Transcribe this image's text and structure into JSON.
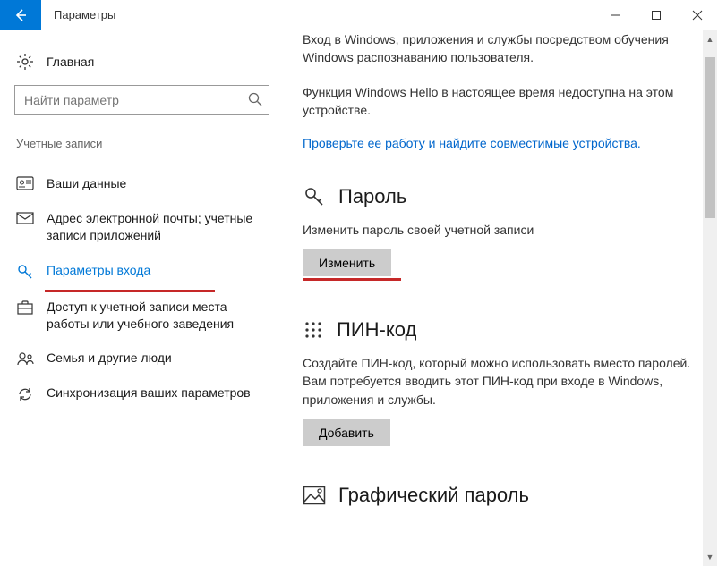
{
  "titlebar": {
    "title": "Параметры"
  },
  "sidebar": {
    "home_label": "Главная",
    "search_placeholder": "Найти параметр",
    "category_label": "Учетные записи",
    "items": [
      {
        "label": "Ваши данные"
      },
      {
        "label": "Адрес электронной почты; учетные записи приложений"
      },
      {
        "label": "Параметры входа"
      },
      {
        "label": "Доступ к учетной записи места работы или учебного заведения"
      },
      {
        "label": "Семья и другие люди"
      },
      {
        "label": "Синхронизация ваших параметров"
      }
    ]
  },
  "main": {
    "hello_text1": "Вход в Windows, приложения и службы посредством обучения Windows распознаванию пользователя.",
    "hello_text2": "Функция Windows Hello в настоящее время недоступна на этом устройстве.",
    "hello_link": "Проверьте ее работу и найдите совместимые устройства.",
    "password": {
      "title": "Пароль",
      "desc": "Изменить пароль своей учетной записи",
      "button": "Изменить"
    },
    "pin": {
      "title": "ПИН-код",
      "desc": "Создайте ПИН-код, который можно использовать вместо паролей. Вам потребуется вводить этот ПИН-код при входе в Windows, приложения и службы.",
      "button": "Добавить"
    },
    "picture": {
      "title": "Графический пароль"
    }
  }
}
